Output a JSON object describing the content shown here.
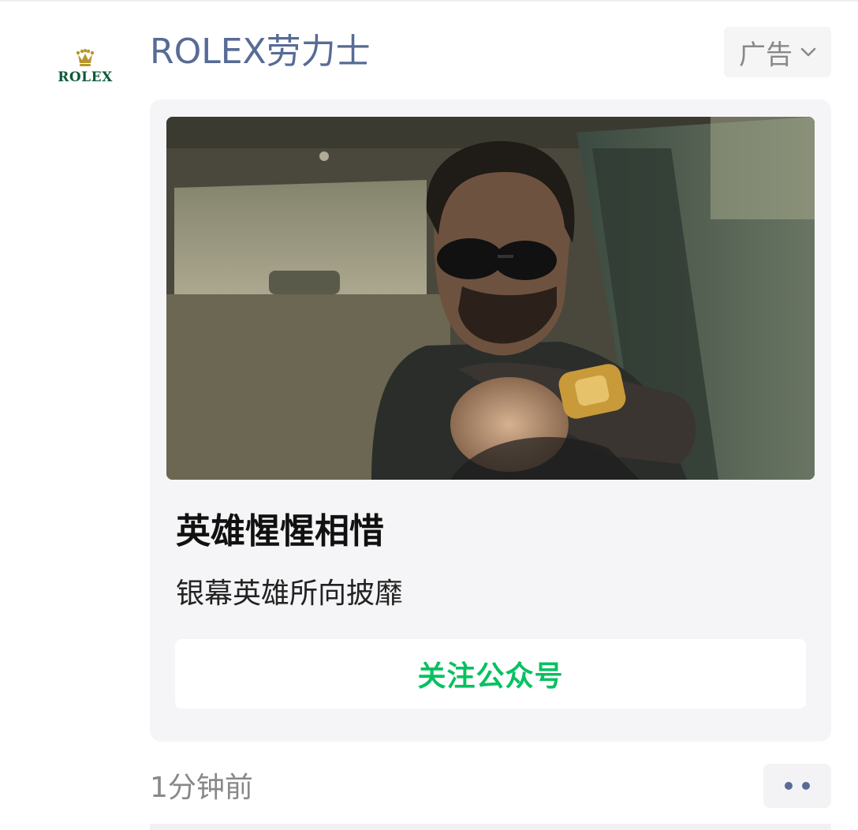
{
  "ad": {
    "brand_name": "ROLEX劳力士",
    "logo_text": "ROLEX",
    "ad_label": "广告",
    "card": {
      "title": "英雄惺惺相惜",
      "subtitle": "银幕英雄所向披靡",
      "button_label": "关注公众号"
    },
    "time": "1分钟前"
  },
  "colors": {
    "link_blue": "#576b95",
    "wechat_green": "#07c160",
    "rolex_green": "#0d5b3a",
    "crown_gold": "#b8962e"
  },
  "icons": {
    "ad_menu": "chevron-down-icon",
    "more": "more-dots-icon",
    "logo": "crown-icon"
  }
}
